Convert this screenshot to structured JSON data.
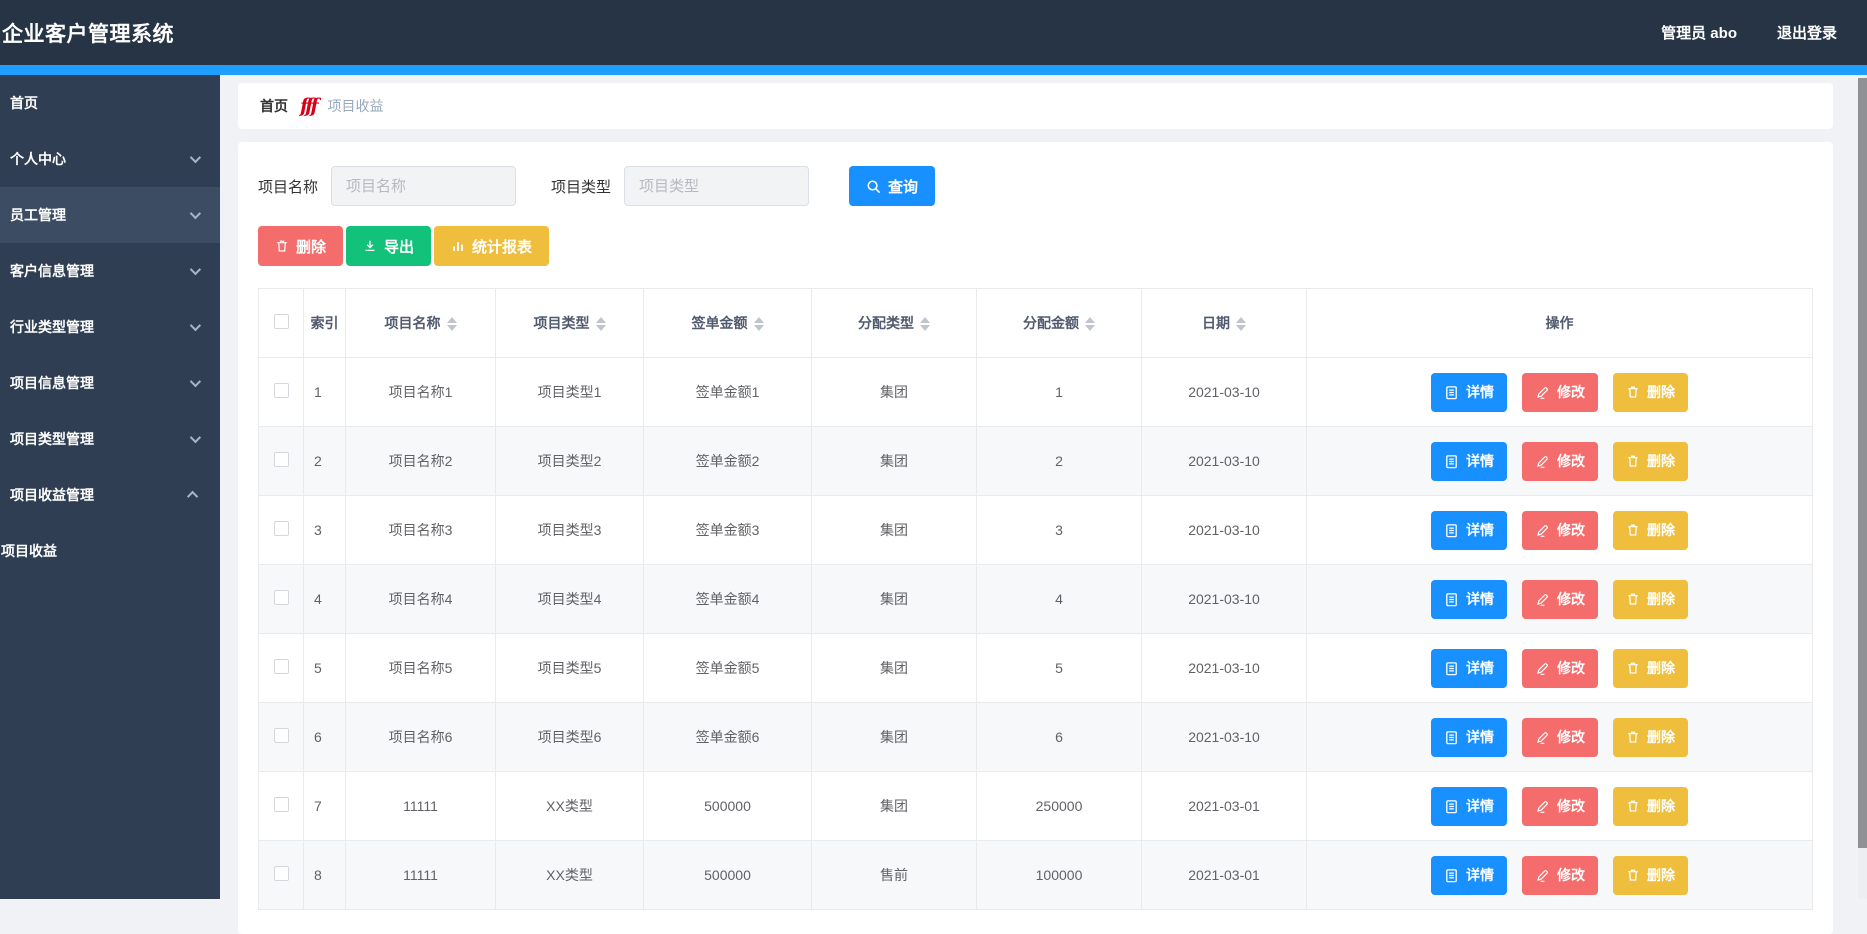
{
  "app": {
    "title": "企业客户管理系统"
  },
  "header": {
    "user_label": "管理员 abo",
    "logout_label": "退出登录"
  },
  "sidebar": {
    "items": [
      {
        "label": "首页",
        "arrow": "none",
        "active": false,
        "submenu": false
      },
      {
        "label": "个人中心",
        "arrow": "down",
        "active": false,
        "submenu": false
      },
      {
        "label": "员工管理",
        "arrow": "down",
        "active": true,
        "submenu": false
      },
      {
        "label": "客户信息管理",
        "arrow": "down",
        "active": false,
        "submenu": false
      },
      {
        "label": "行业类型管理",
        "arrow": "down",
        "active": false,
        "submenu": false
      },
      {
        "label": "项目信息管理",
        "arrow": "down",
        "active": false,
        "submenu": false
      },
      {
        "label": "项目类型管理",
        "arrow": "down",
        "active": false,
        "submenu": false
      },
      {
        "label": "项目收益管理",
        "arrow": "up",
        "active": false,
        "submenu": false
      },
      {
        "label": "项目收益",
        "arrow": "none",
        "active": false,
        "submenu": true
      }
    ]
  },
  "breadcrumb": {
    "home": "首页",
    "separator_glyph": "fff",
    "current": "项目收益"
  },
  "filters": {
    "name_label": "项目名称",
    "name_placeholder": "项目名称",
    "name_value": "",
    "type_label": "项目类型",
    "type_placeholder": "项目类型",
    "type_value": "",
    "search_label": "查询"
  },
  "toolbar": {
    "delete_label": "删除",
    "export_label": "导出",
    "report_label": "统计报表"
  },
  "table": {
    "columns": [
      {
        "label": "索引",
        "sortable": false
      },
      {
        "label": "项目名称",
        "sortable": true
      },
      {
        "label": "项目类型",
        "sortable": true
      },
      {
        "label": "签单金额",
        "sortable": true
      },
      {
        "label": "分配类型",
        "sortable": true
      },
      {
        "label": "分配金额",
        "sortable": true
      },
      {
        "label": "日期",
        "sortable": true
      },
      {
        "label": "操作",
        "sortable": false
      }
    ],
    "rows": [
      [
        "1",
        "项目名称1",
        "项目类型1",
        "签单金额1",
        "集团",
        "1",
        "2021-03-10"
      ],
      [
        "2",
        "项目名称2",
        "项目类型2",
        "签单金额2",
        "集团",
        "2",
        "2021-03-10"
      ],
      [
        "3",
        "项目名称3",
        "项目类型3",
        "签单金额3",
        "集团",
        "3",
        "2021-03-10"
      ],
      [
        "4",
        "项目名称4",
        "项目类型4",
        "签单金额4",
        "集团",
        "4",
        "2021-03-10"
      ],
      [
        "5",
        "项目名称5",
        "项目类型5",
        "签单金额5",
        "集团",
        "5",
        "2021-03-10"
      ],
      [
        "6",
        "项目名称6",
        "项目类型6",
        "签单金额6",
        "集团",
        "6",
        "2021-03-10"
      ],
      [
        "7",
        "11111",
        "XX类型",
        "500000",
        "集团",
        "250000",
        "2021-03-01"
      ],
      [
        "8",
        "11111",
        "XX类型",
        "500000",
        "售前",
        "100000",
        "2021-03-01"
      ]
    ],
    "row_actions": [
      {
        "label": "详情",
        "icon": "document-icon",
        "class": "btn-blue",
        "name": "detail-button"
      },
      {
        "label": "修改",
        "icon": "pencil-icon",
        "class": "btn-red",
        "name": "edit-button"
      },
      {
        "label": "删除",
        "icon": "trash-icon",
        "class": "btn-yellow",
        "name": "delete-button"
      }
    ]
  },
  "colors": {
    "primary": "#1990ff",
    "accent_bar": "#1e9fff",
    "danger": "#f56c6c",
    "success": "#13c27a",
    "warning": "#eebe3c",
    "header_bg": "#263445",
    "sidebar_bg": "#2f3e52",
    "sidebar_active_bg": "#3c4d63",
    "page_bg": "#f0f2f5",
    "breadcrumb_sep": "#d60018"
  }
}
